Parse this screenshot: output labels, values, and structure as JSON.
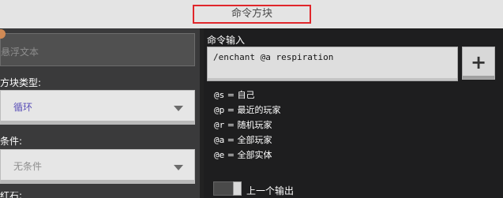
{
  "window": {
    "title": "命令方块"
  },
  "left": {
    "hover_placeholder": "悬浮文本",
    "block_type_label": "方块类型:",
    "block_type_value": "循环",
    "condition_label": "条件:",
    "condition_value": "无条件",
    "redstone_label": "红石:"
  },
  "right": {
    "command_label": "命令输入",
    "command_value": "/enchant @a respiration",
    "add_button": "+",
    "selectors": [
      {
        "code": "@s",
        "desc": "自己"
      },
      {
        "code": "@p",
        "desc": "最近的玩家"
      },
      {
        "code": "@r",
        "desc": "随机玩家"
      },
      {
        "code": "@a",
        "desc": "全部玩家"
      },
      {
        "code": "@e",
        "desc": "全部实体"
      }
    ],
    "previous_output_label": "上一个输出"
  },
  "colors": {
    "title_highlight": "#e0262b",
    "block_type_value": "#5a4fb8",
    "condition_value": "#8e8e8e"
  }
}
